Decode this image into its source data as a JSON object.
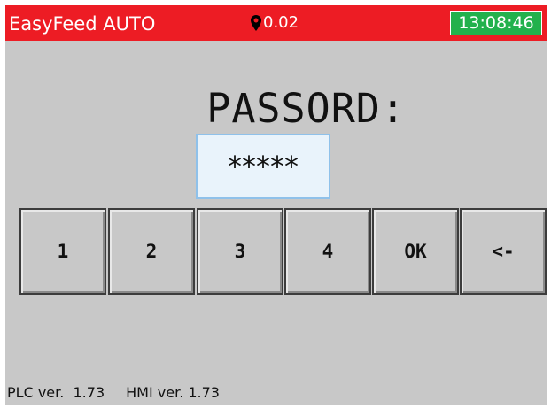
{
  "title_bar": {
    "app_title": "EasyFeed AUTO",
    "location_icon": "map-pin-icon",
    "location_value": "0.02",
    "clock": "13:08:46"
  },
  "login": {
    "label": "PASSORD:",
    "input_value": "*****"
  },
  "keypad": {
    "keys": [
      "1",
      "2",
      "3",
      "4",
      "OK",
      "<-"
    ]
  },
  "footer": {
    "plc_version": "PLC ver.  1.73",
    "hmi_version": "HMI ver. 1.73"
  },
  "colors": {
    "title_bar": "#ed1c24",
    "clock_background": "#22b14c",
    "screen_background": "#c8c8c8",
    "input_border": "#8fc1ea"
  }
}
